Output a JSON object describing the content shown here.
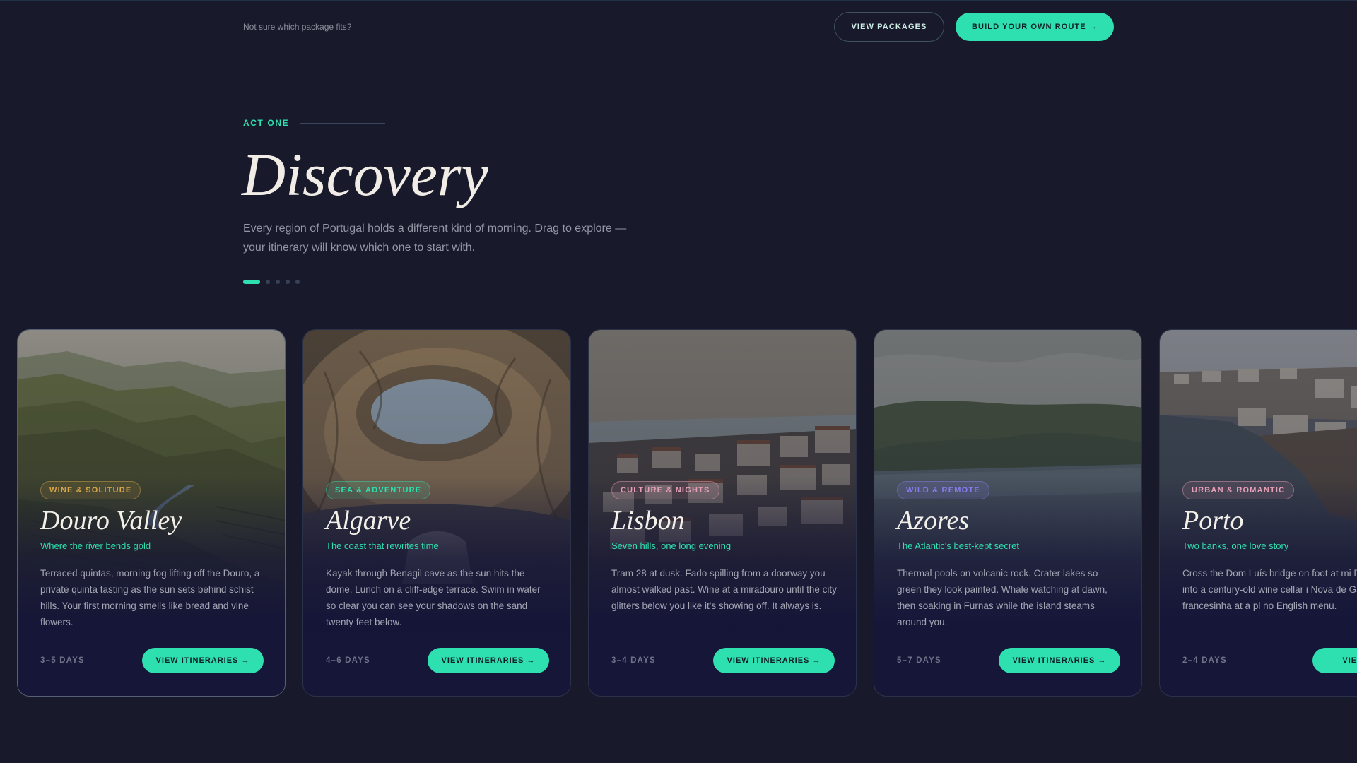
{
  "topbar": {
    "hint": "Not sure which package fits?",
    "view_packages": "VIEW PACKAGES",
    "build_route": "BUILD YOUR OWN ROUTE →"
  },
  "hero": {
    "kicker": "ACT ONE",
    "title": "Discovery",
    "lede": "Every region of Portugal holds a different kind of morning. Drag to explore — your itinerary will know which one to start with.",
    "pager": {
      "count": 5,
      "active": 1
    }
  },
  "colors": {
    "background": "#181a2c",
    "accent": "#2ee0b0"
  },
  "cards": [
    {
      "tag": "WINE & SOLITUDE",
      "tag_color": "#d9a74a",
      "name": "Douro Valley",
      "tagline": "Where the river bends gold",
      "description": "Terraced quintas, morning fog lifting off the Douro, a private quinta tasting as the sun sets behind schist hills. Your first morning smells like bread and vine flowers.",
      "days": "3–5 DAYS",
      "cta": "VIEW ITINERARIES →"
    },
    {
      "tag": "SEA & ADVENTURE",
      "tag_color": "#2ee0b0",
      "name": "Algarve",
      "tagline": "The coast that rewrites time",
      "description": "Kayak through Benagil cave as the sun hits the dome. Lunch on a cliff-edge terrace. Swim in water so clear you can see your shadows on the sand twenty feet below.",
      "days": "4–6 DAYS",
      "cta": "VIEW ITINERARIES →"
    },
    {
      "tag": "CULTURE & NIGHTS",
      "tag_color": "#e8a0b8",
      "name": "Lisbon",
      "tagline": "Seven hills, one long evening",
      "description": "Tram 28 at dusk. Fado spilling from a doorway you almost walked past. Wine at a miradouro until the city glitters below you like it's showing off. It always is.",
      "days": "3–4 DAYS",
      "cta": "VIEW ITINERARIES →"
    },
    {
      "tag": "WILD & REMOTE",
      "tag_color": "#8a7cf0",
      "name": "Azores",
      "tagline": "The Atlantic's best-kept secret",
      "description": "Thermal pools on volcanic rock. Crater lakes so green they look painted. Whale watching at dawn, then soaking in Furnas while the island steams around you.",
      "days": "5–7 DAYS",
      "cta": "VIEW ITINERARIES →"
    },
    {
      "tag": "URBAN & ROMANTIC",
      "tag_color": "#e8a0b8",
      "name": "Porto",
      "tagline": "Two banks, one love story",
      "description": "Cross the Dom Luís bridge on foot at mi Descend into a century-old wine cellar i Nova de Gaia. Order francesinha at a pl no English menu.",
      "days": "2–4 DAYS",
      "cta": "VIEW ITINERA"
    }
  ]
}
